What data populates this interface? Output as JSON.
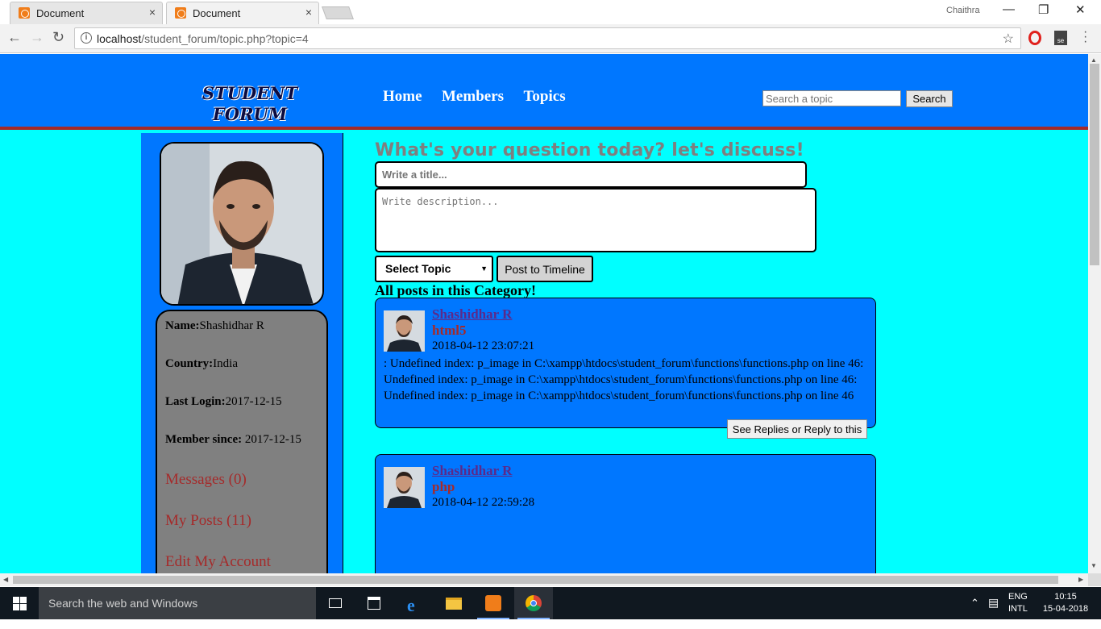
{
  "browser": {
    "tabs": [
      {
        "title": "Document",
        "close": "×"
      },
      {
        "title": "Document",
        "close": "×"
      }
    ],
    "profile_name": "Chaithra",
    "window_controls": {
      "minimize": "—",
      "restore": "❐",
      "close": "✕"
    },
    "url_host": "localhost",
    "url_path": "/student_forum/topic.php?topic=4",
    "icons": [
      "back-icon",
      "forward-icon",
      "reload-icon",
      "info-icon",
      "star-icon",
      "opera-icon",
      "se-icon",
      "menu-icon"
    ]
  },
  "site": {
    "logo_line1": "STUDENT",
    "logo_line2": "FORUM",
    "nav": {
      "home": "Home",
      "members": "Members",
      "topics": "Topics"
    },
    "search": {
      "placeholder": "Search a topic",
      "button": "Search"
    },
    "colors": {
      "header": "#0077ff",
      "page_bg": "#00ffff",
      "accent": "#a52a2a"
    }
  },
  "profile": {
    "name_label": "Name:",
    "name": "Shashidhar R",
    "country_label": "Country:",
    "country": "India",
    "last_login_label": "Last Login:",
    "last_login": "2017-12-15",
    "member_since_label": "Member since:",
    "member_since": " 2017-12-15",
    "messages_link": "Messages (0)",
    "my_posts_link": "My Posts (11)",
    "edit_account_link": "Edit My Account"
  },
  "composer": {
    "question": "What's your question today? let's discuss!",
    "title_placeholder": "Write a title...",
    "desc_placeholder": "Write description...",
    "topic_select": "Select Topic",
    "post_button": "Post to Timeline"
  },
  "posts_section_title": "All posts in this Category!",
  "posts": [
    {
      "author": "Shashidhar R",
      "topic": "html5",
      "date": "2018-04-12 23:07:21",
      "body": ": Undefined index: p_image in C:\\xampp\\htdocs\\student_forum\\functions\\functions.php on line 46: Undefined index: p_image in C:\\xampp\\htdocs\\student_forum\\functions\\functions.php on line 46: Undefined index: p_image in C:\\xampp\\htdocs\\student_forum\\functions\\functions.php on line 46",
      "reply_button": "See Replies or Reply to this"
    },
    {
      "author": "Shashidhar R",
      "topic": "php",
      "date": "2018-04-12 22:59:28"
    }
  ],
  "taskbar": {
    "search_placeholder": "Search the web and Windows",
    "lang1": "ENG",
    "lang2": "INTL",
    "time": "10:15",
    "date": "15-04-2018"
  }
}
